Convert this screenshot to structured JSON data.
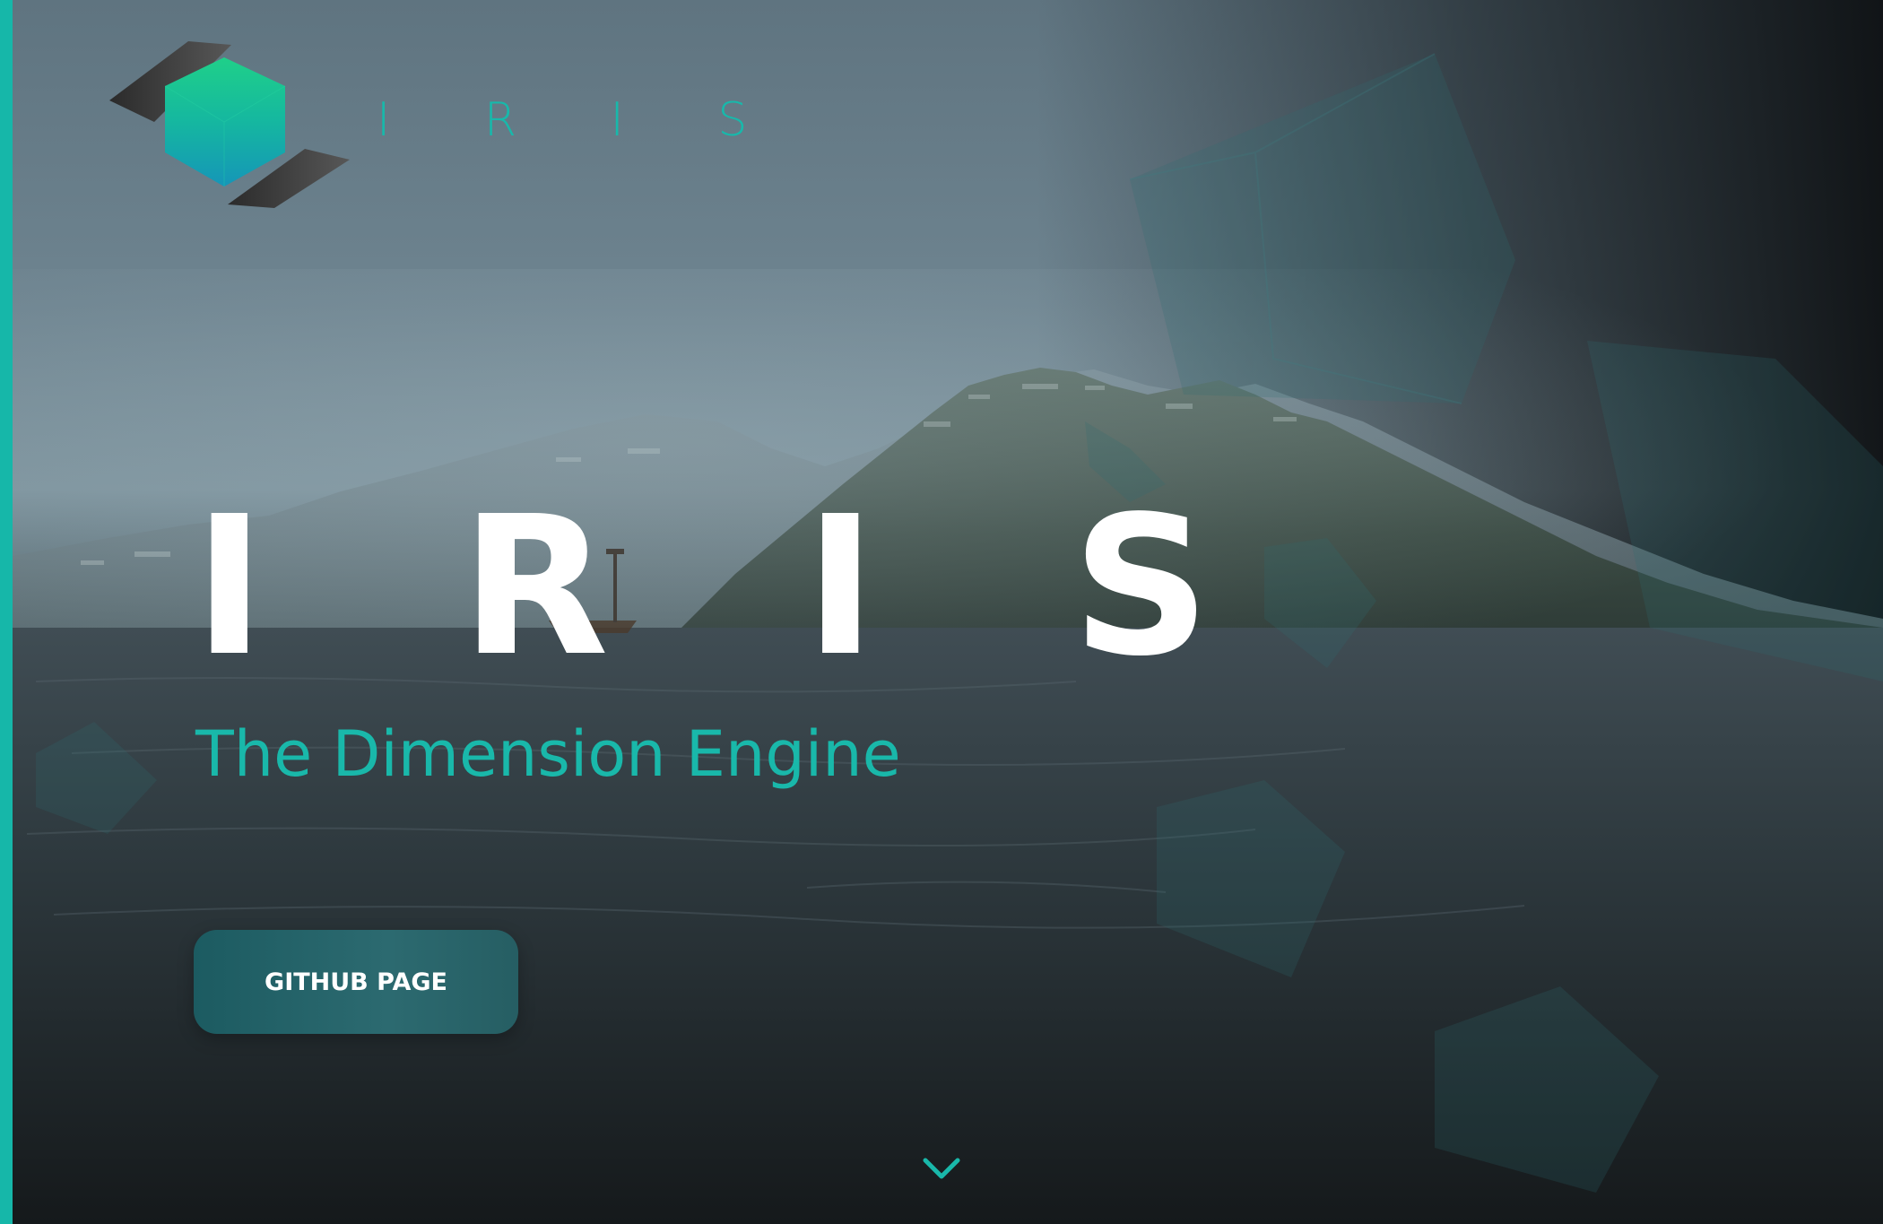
{
  "header": {
    "brand_name": "I R I S",
    "logo_icon": "hexagon-logo-icon"
  },
  "hero": {
    "title": "I R I S",
    "subtitle": "The Dimension Engine",
    "button_label": "GITHUB PAGE",
    "scroll_icon": "chevron-down-icon"
  },
  "colors": {
    "accent": "#16b7a9",
    "title": "#ffffff",
    "button": "#245f64"
  }
}
